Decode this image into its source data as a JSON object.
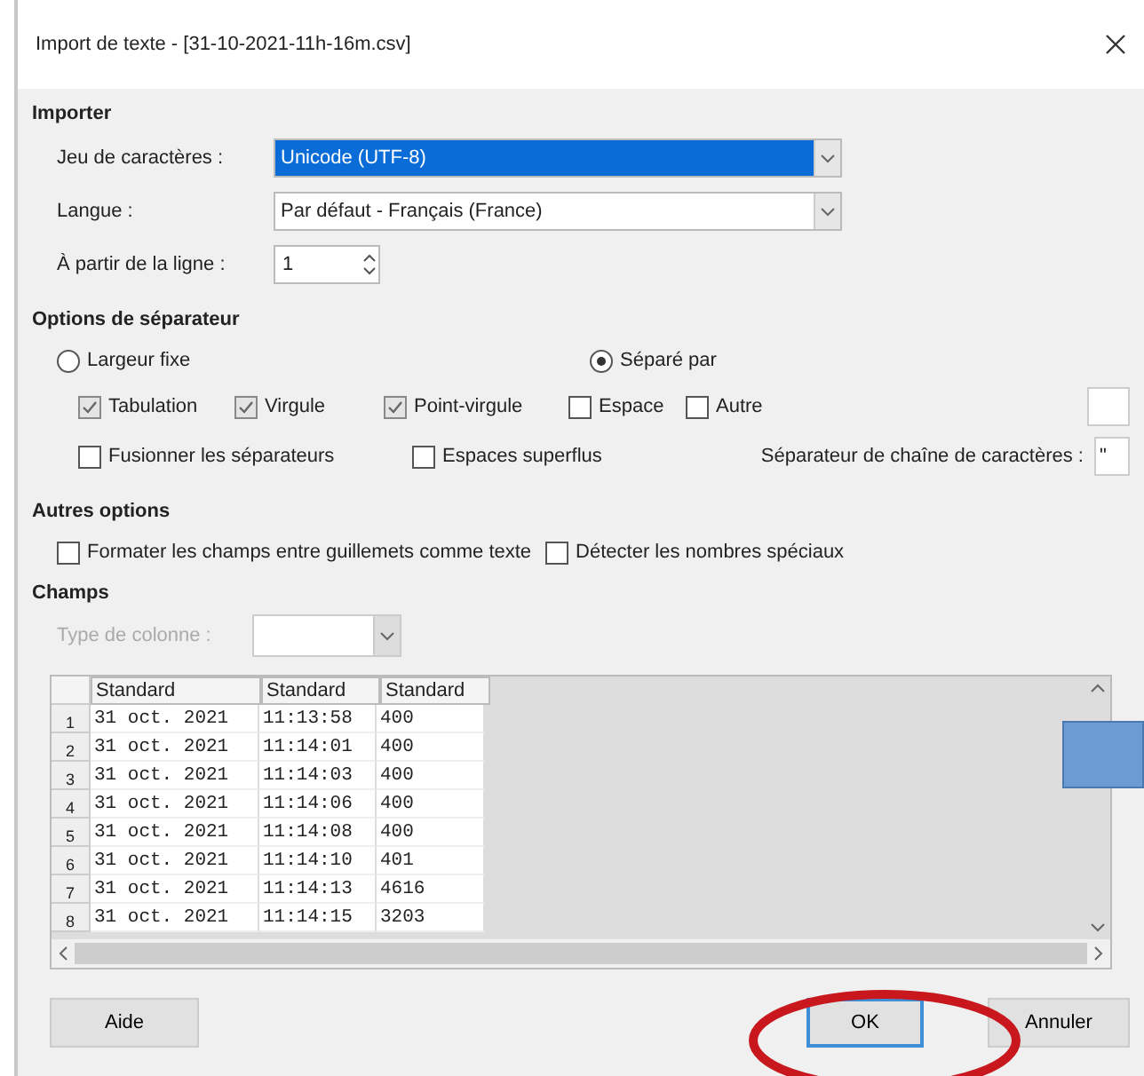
{
  "window": {
    "title": "Import de texte - [31-10-2021-11h-16m.csv]"
  },
  "import": {
    "title": "Importer",
    "charset": {
      "label": "Jeu de caractères :",
      "value": "Unicode (UTF-8)"
    },
    "language": {
      "label": "Langue :",
      "value": "Par défaut - Français (France)"
    },
    "from_line": {
      "label": "À partir de la ligne :",
      "value": "1"
    }
  },
  "separator_options": {
    "title": "Options de séparateur",
    "modes": [
      {
        "label": "Largeur fixe",
        "selected": false
      },
      {
        "label": "Séparé par",
        "selected": true
      }
    ],
    "separators": [
      {
        "label": "Tabulation",
        "checked": true
      },
      {
        "label": "Virgule",
        "checked": true
      },
      {
        "label": "Point-virgule",
        "checked": true
      },
      {
        "label": "Espace",
        "checked": false
      },
      {
        "label": "Autre",
        "checked": false
      }
    ],
    "merge": [
      {
        "label": "Fusionner les séparateurs",
        "checked": false
      },
      {
        "label": "Espaces superflus",
        "checked": false
      }
    ],
    "string_delimiter": {
      "label": "Séparateur de chaîne de caractères :",
      "value": "\""
    }
  },
  "other_options": {
    "title": "Autres options",
    "options": [
      {
        "label": "Formater les champs entre guillemets comme texte",
        "checked": false
      },
      {
        "label": "Détecter les nombres spéciaux",
        "checked": false
      }
    ]
  },
  "fields": {
    "title": "Champs",
    "column_type": {
      "label": "Type de colonne :",
      "disabled": true
    },
    "table": {
      "columns": [
        "Standard",
        "Standard",
        "Standard"
      ],
      "rows": [
        {
          "num": "1",
          "cells": [
            "31 oct. 2021",
            "11:13:58",
            "400"
          ]
        },
        {
          "num": "2",
          "cells": [
            "31 oct. 2021",
            "11:14:01",
            "400"
          ]
        },
        {
          "num": "3",
          "cells": [
            "31 oct. 2021",
            "11:14:03",
            "400"
          ]
        },
        {
          "num": "4",
          "cells": [
            "31 oct. 2021",
            "11:14:06",
            "400"
          ]
        },
        {
          "num": "5",
          "cells": [
            "31 oct. 2021",
            "11:14:08",
            "400"
          ]
        },
        {
          "num": "6",
          "cells": [
            "31 oct. 2021",
            "11:14:10",
            "401"
          ]
        },
        {
          "num": "7",
          "cells": [
            "31 oct. 2021",
            "11:14:13",
            "4616"
          ]
        },
        {
          "num": "8",
          "cells": [
            "31 oct. 2021",
            "11:14:15",
            "3203"
          ]
        }
      ]
    }
  },
  "buttons": [
    {
      "label": "Aide",
      "kind": "help"
    },
    {
      "label": "OK",
      "kind": "default"
    },
    {
      "label": "Annuler",
      "kind": "cancel"
    }
  ]
}
